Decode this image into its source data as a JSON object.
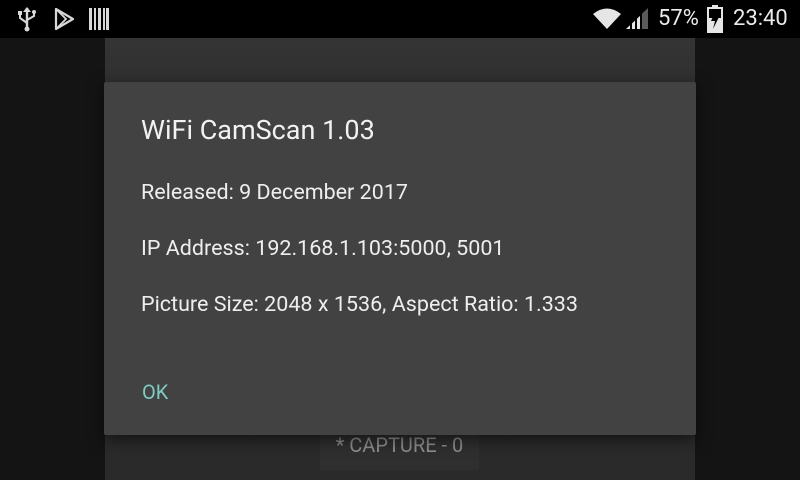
{
  "status_bar": {
    "battery_percent": "57%",
    "time": "23:40",
    "icons": [
      "usb-icon",
      "play-store-icon",
      "barcode-icon",
      "wifi-icon",
      "signal-icon",
      "battery-icon"
    ]
  },
  "capture_button": {
    "label": "* CAPTURE - 0"
  },
  "dialog": {
    "title": "WiFi CamScan 1.03",
    "lines": [
      "Released: 9 December 2017",
      "IP Address: 192.168.1.103:5000, 5001",
      "Picture Size: 2048 x 1536, Aspect Ratio: 1.333"
    ],
    "ok_label": "OK"
  },
  "colors": {
    "dialog_bg": "#424242",
    "accent": "#7fcbc4",
    "status_bar_bg": "#000000"
  }
}
